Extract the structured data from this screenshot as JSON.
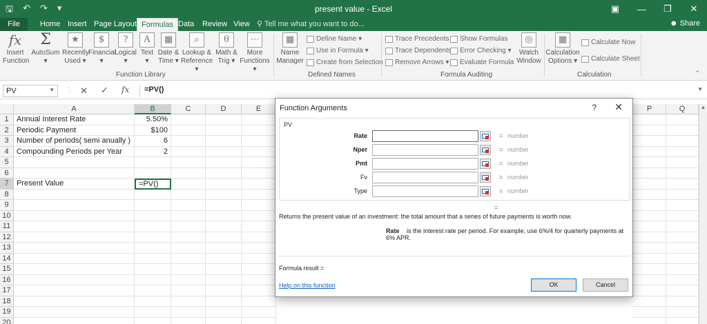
{
  "titlebar": {
    "title": "present value - Excel",
    "qat": {
      "save_icon": "save-icon",
      "undo_icon": "undo-icon",
      "redo_icon": "redo-icon",
      "customize_icon": "customize-icon"
    },
    "window": {
      "minimize": "—",
      "restore": "❐",
      "close": "✕",
      "ribbon_options": "▣"
    }
  },
  "tabs": {
    "file": "File",
    "items": [
      "Home",
      "Insert",
      "Page Layout",
      "Formulas",
      "Data",
      "Review",
      "View"
    ],
    "active": "Formulas",
    "tell_me": "Tell me what you want to do...",
    "share": "Share"
  },
  "ribbon": {
    "function_library": {
      "label": "Function Library",
      "buttons": [
        {
          "line1": "Insert",
          "line2": "Function",
          "icon": "fx"
        },
        {
          "line1": "AutoSum",
          "line2": "▾",
          "icon": "Σ"
        },
        {
          "line1": "Recently",
          "line2": "Used ▾",
          "icon": "★"
        },
        {
          "line1": "Financial",
          "line2": "▾",
          "icon": "$"
        },
        {
          "line1": "Logical",
          "line2": "▾",
          "icon": "?"
        },
        {
          "line1": "Text",
          "line2": "▾",
          "icon": "A"
        },
        {
          "line1": "Date &",
          "line2": "Time ▾",
          "icon": "▦"
        },
        {
          "line1": "Lookup &",
          "line2": "Reference ▾",
          "icon": "⌕"
        },
        {
          "line1": "Math &",
          "line2": "Trig ▾",
          "icon": "θ"
        },
        {
          "line1": "More",
          "line2": "Functions ▾",
          "icon": "⋯"
        }
      ]
    },
    "defined_names": {
      "label": "Defined Names",
      "name_manager": {
        "line1": "Name",
        "line2": "Manager"
      },
      "define_name": "Define Name ▾",
      "use_in_formula": "Use in Formula ▾",
      "create_from_selection": "Create from Selection"
    },
    "formula_auditing": {
      "label": "Formula Auditing",
      "trace_precedents": "Trace Precedents",
      "trace_dependents": "Trace Dependents",
      "remove_arrows": "Remove Arrows ▾",
      "show_formulas": "Show Formulas",
      "error_checking": "Error Checking ▾",
      "evaluate_formula": "Evaluate Formula",
      "watch_window": {
        "line1": "Watch",
        "line2": "Window"
      }
    },
    "calculation": {
      "label": "Calculation",
      "calculation_options": {
        "line1": "Calculation",
        "line2": "Options ▾"
      },
      "calculate_now": "Calculate Now",
      "calculate_sheet": "Calculate Sheet"
    }
  },
  "formula_bar": {
    "name_box": "PV",
    "cancel": "✕",
    "enter": "✓",
    "fx": "fx",
    "formula": "=PV()"
  },
  "grid": {
    "columns": [
      "A",
      "B",
      "C",
      "D",
      "E",
      "P",
      "Q"
    ],
    "selected_column": "B",
    "rows": [
      "1",
      "2",
      "3",
      "4",
      "5",
      "6",
      "7",
      "8",
      "9",
      "10",
      "11",
      "12",
      "13",
      "14",
      "15",
      "16",
      "17",
      "18",
      "19",
      "20"
    ],
    "selected_row": "7",
    "cells": {
      "A1": "Annual Interest Rate",
      "B1": "5.50%",
      "A2": "Periodic Payment",
      "B2": "$100",
      "A3": "Number of periods( semi anually )",
      "B3": "6",
      "A4": "Compounding Periods per Year",
      "B4": "2",
      "A7": "Present Value",
      "B7": "=PV()"
    }
  },
  "dialog": {
    "title": "Function Arguments",
    "help": "?",
    "close": "✕",
    "function_name": "PV",
    "args": [
      {
        "name": "Rate",
        "bold": true,
        "value": "",
        "hint": "number"
      },
      {
        "name": "Nper",
        "bold": true,
        "value": "",
        "hint": "number"
      },
      {
        "name": "Pmt",
        "bold": true,
        "value": "",
        "hint": "number"
      },
      {
        "name": "Fv",
        "bold": false,
        "value": "",
        "hint": "number"
      },
      {
        "name": "Type",
        "bold": false,
        "value": "",
        "hint": "number"
      }
    ],
    "equals": "=",
    "description": "Returns the present value of an investment: the total amount that a series of future payments is worth now.",
    "arg_description_name": "Rate",
    "arg_description": "is the interest rate per period. For example, use 6%/4 for quarterly payments at 6% APR.",
    "formula_result": "Formula result =",
    "help_link": "Help on this function",
    "ok": "OK",
    "cancel": "Cancel"
  }
}
